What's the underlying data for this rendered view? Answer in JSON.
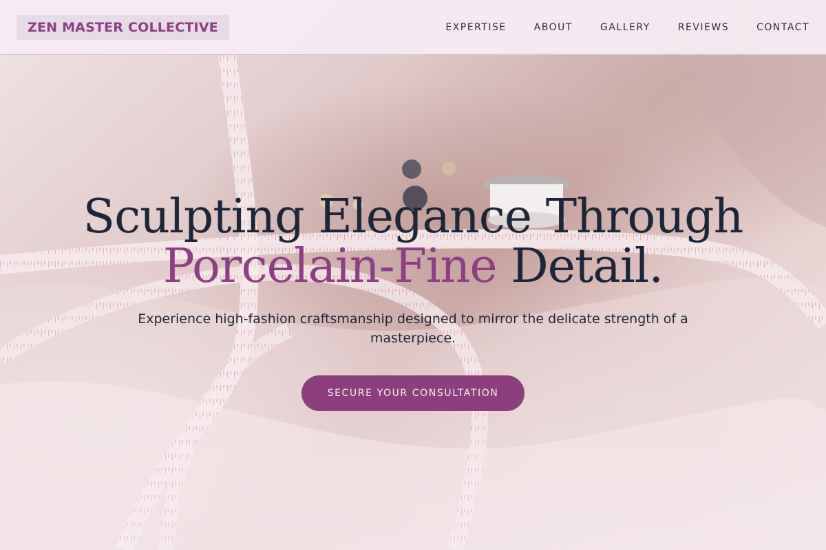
{
  "brand": {
    "name": "ZEN MASTER COLLECTIVE"
  },
  "nav": {
    "items": [
      {
        "label": "EXPERTISE"
      },
      {
        "label": "ABOUT"
      },
      {
        "label": "GALLERY"
      },
      {
        "label": "REVIEWS"
      },
      {
        "label": "CONTACT"
      }
    ]
  },
  "hero": {
    "headline_line1": "Sculpting Elegance Through",
    "headline_accent": "Porcelain-Fine",
    "headline_end": " Detail.",
    "subtitle": "Experience high-fashion craftsmanship designed to mirror the delicate strength of a masterpiece.",
    "cta_label": "SECURE YOUR CONSULTATION"
  },
  "colors": {
    "accent": "#8c3f82",
    "text": "#1e2537",
    "header_bg": "#f8ecf4",
    "cta_bg": "#8b3f7e"
  }
}
